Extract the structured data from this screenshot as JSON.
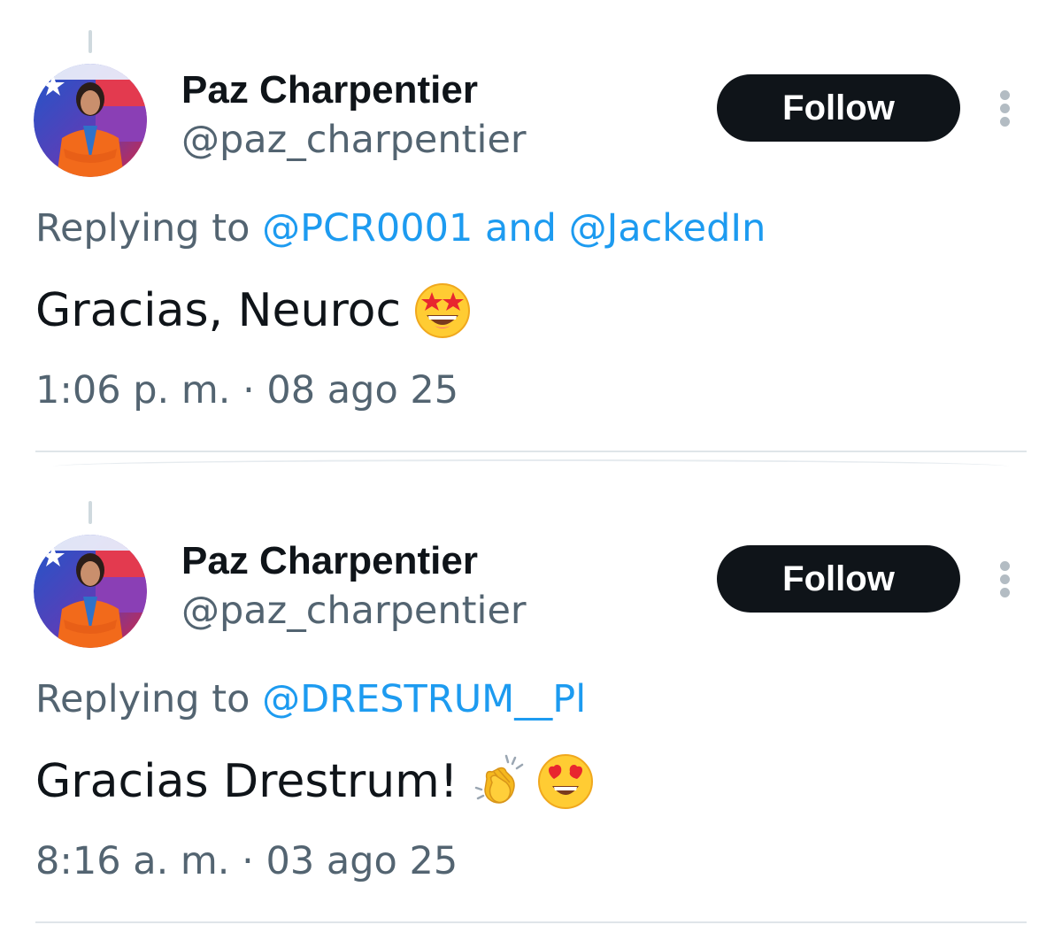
{
  "colors": {
    "text_primary": "#0f1419",
    "text_secondary": "#536471",
    "link": "#1d9bf0",
    "follow_bg": "#0f1419",
    "divider": "#dfe5e9"
  },
  "tweets": [
    {
      "author_name": "Paz Charpentier",
      "author_handle": "@paz_charpentier",
      "follow_label": "Follow",
      "replying_prefix": "Replying to",
      "replying_to": [
        "@PCR0001",
        "@JackedIn"
      ],
      "replying_joiner": "and",
      "text": "Gracias, Neuroc",
      "emojis": [
        "star-struck-emoji"
      ],
      "timestamp": "1:06 p. m. · 08 ago 25"
    },
    {
      "author_name": "Paz Charpentier",
      "author_handle": "@paz_charpentier",
      "follow_label": "Follow",
      "replying_prefix": "Replying to",
      "replying_to": [
        "@DRESTRUM__Pl"
      ],
      "text": "Gracias Drestrum!",
      "emojis": [
        "clapping-hands-emoji",
        "heart-eyes-emoji"
      ],
      "timestamp": "8:16 a. m. · 03 ago 25"
    }
  ]
}
